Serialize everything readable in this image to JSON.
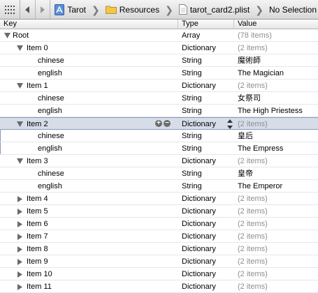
{
  "jumpbar": {
    "breadcrumbs": [
      {
        "label": "Tarot",
        "icon": "project-icon"
      },
      {
        "label": "Resources",
        "icon": "folder-icon"
      },
      {
        "label": "tarot_card2.plist",
        "icon": "plist-file-icon"
      },
      {
        "label": "No Selection",
        "icon": ""
      }
    ]
  },
  "columns": {
    "key": "Key",
    "type": "Type",
    "value": "Value"
  },
  "colors": {
    "selection": "#d6dde9",
    "muted_text": "#8e8e8e",
    "folder": "#f2c74b"
  },
  "rows": [
    {
      "key": "Root",
      "type": "Array",
      "value": "(78 items)",
      "level": 0,
      "disclosure": "expanded",
      "muted": true
    },
    {
      "key": "Item 0",
      "type": "Dictionary",
      "value": "(2 items)",
      "level": 1,
      "disclosure": "expanded",
      "muted": true
    },
    {
      "key": "chinese",
      "type": "String",
      "value": "魔術師",
      "level": 2,
      "disclosure": "none",
      "muted": false
    },
    {
      "key": "english",
      "type": "String",
      "value": "The Magician",
      "level": 2,
      "disclosure": "none",
      "muted": false
    },
    {
      "key": "Item 1",
      "type": "Dictionary",
      "value": "(2 items)",
      "level": 1,
      "disclosure": "expanded",
      "muted": true
    },
    {
      "key": "chinese",
      "type": "String",
      "value": "女祭司",
      "level": 2,
      "disclosure": "none",
      "muted": false
    },
    {
      "key": "english",
      "type": "String",
      "value": "The High Priestess",
      "level": 2,
      "disclosure": "none",
      "muted": false
    },
    {
      "key": "Item 2",
      "type": "Dictionary",
      "value": "(2 items)",
      "level": 1,
      "disclosure": "expanded",
      "muted": true,
      "selected": true
    },
    {
      "key": "chinese",
      "type": "String",
      "value": "皇后",
      "level": 2,
      "disclosure": "none",
      "muted": false
    },
    {
      "key": "english",
      "type": "String",
      "value": "The Empress",
      "level": 2,
      "disclosure": "none",
      "muted": false
    },
    {
      "key": "Item 3",
      "type": "Dictionary",
      "value": "(2 items)",
      "level": 1,
      "disclosure": "expanded",
      "muted": true
    },
    {
      "key": "chinese",
      "type": "String",
      "value": "皇帝",
      "level": 2,
      "disclosure": "none",
      "muted": false
    },
    {
      "key": "english",
      "type": "String",
      "value": "The Emperor",
      "level": 2,
      "disclosure": "none",
      "muted": false
    },
    {
      "key": "Item 4",
      "type": "Dictionary",
      "value": "(2 items)",
      "level": 1,
      "disclosure": "collapsed",
      "muted": true
    },
    {
      "key": "Item 5",
      "type": "Dictionary",
      "value": "(2 items)",
      "level": 1,
      "disclosure": "collapsed",
      "muted": true
    },
    {
      "key": "Item 6",
      "type": "Dictionary",
      "value": "(2 items)",
      "level": 1,
      "disclosure": "collapsed",
      "muted": true
    },
    {
      "key": "Item 7",
      "type": "Dictionary",
      "value": "(2 items)",
      "level": 1,
      "disclosure": "collapsed",
      "muted": true
    },
    {
      "key": "Item 8",
      "type": "Dictionary",
      "value": "(2 items)",
      "level": 1,
      "disclosure": "collapsed",
      "muted": true
    },
    {
      "key": "Item 9",
      "type": "Dictionary",
      "value": "(2 items)",
      "level": 1,
      "disclosure": "collapsed",
      "muted": true
    },
    {
      "key": "Item 10",
      "type": "Dictionary",
      "value": "(2 items)",
      "level": 1,
      "disclosure": "collapsed",
      "muted": true
    },
    {
      "key": "Item 11",
      "type": "Dictionary",
      "value": "(2 items)",
      "level": 1,
      "disclosure": "collapsed",
      "muted": true
    }
  ]
}
